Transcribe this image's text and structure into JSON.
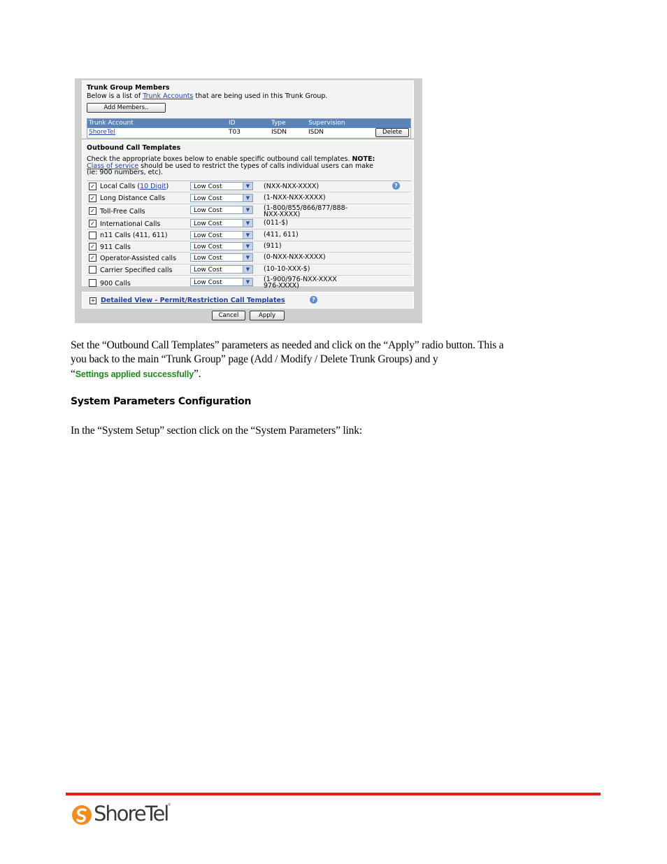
{
  "screenshot": {
    "members": {
      "title": "Trunk Group Members",
      "desc_pre": "Below is a list of ",
      "desc_link": "Trunk Accounts",
      "desc_post": " that are being used in this Trunk Group.",
      "add_button": "Add Members..",
      "columns": [
        "Trunk Account",
        "ID",
        "Type",
        "Supervision"
      ],
      "row": {
        "account": "ShoreTel",
        "id": "T03",
        "type": "ISDN",
        "supervision": "ISDN",
        "action": "Delete"
      }
    },
    "templates": {
      "title": "Outbound Call Templates",
      "desc_line1_pre": "Check the appropriate boxes below to enable specific outbound call templates. ",
      "desc_note": "NOTE:",
      "desc_link": "Class of service",
      "desc_line2_post": " should be used to restrict the types of calls individual users can make",
      "desc_line3": "(ie: 900 numbers, etc).",
      "rows": [
        {
          "checked": true,
          "label": "Local Calls (",
          "link": "10 Digit",
          "label_post": ")",
          "select": "Low Cost",
          "pattern": "(NXX-NXX-XXXX)"
        },
        {
          "checked": true,
          "label": "Long Distance Calls",
          "select": "Low Cost",
          "pattern": "(1-NXX-NXX-XXXX)"
        },
        {
          "checked": true,
          "label": "Toll-Free Calls",
          "select": "Low Cost",
          "pattern": "(1-800/855/866/877/888-\nNXX-XXXX)"
        },
        {
          "checked": true,
          "label": "International Calls",
          "select": "Low Cost",
          "pattern": "(011-$)"
        },
        {
          "checked": false,
          "label": "n11 Calls (411, 611)",
          "select": "Low Cost",
          "pattern": "(411, 611)"
        },
        {
          "checked": true,
          "label": "911 Calls",
          "select": "Low Cost",
          "pattern": "(911)"
        },
        {
          "checked": true,
          "label": "Operator-Assisted calls",
          "select": "Low Cost",
          "pattern": "(0-NXX-NXX-XXXX)"
        },
        {
          "checked": false,
          "label": "Carrier Specified calls",
          "select": "Low Cost",
          "pattern": "(10-10-XXX-$)"
        },
        {
          "checked": false,
          "label": "900 Calls",
          "select": "Low Cost",
          "pattern": "(1-900/976-NXX-XXXX\n976-XXXX)"
        }
      ]
    },
    "detail_link": "Detailed View - Permit/Restriction Call Templates",
    "expand_glyph": "+",
    "cancel_button": "Cancel",
    "apply_button": "Apply"
  },
  "body": {
    "para1_line1": "Set the “Outbound Call Templates” parameters as needed and click on the “Apply” radio button.  This a",
    "para1_line2": "you back to the main “Trunk Group” page (Add / Modify / Delete Trunk Groups) and y",
    "para1_open_quote": "“",
    "success_msg": "Settings applied successfully",
    "para1_close": "”.",
    "heading": "System Parameters Configuration",
    "para2": "In the “System Setup” section click on the “System Parameters” link:"
  },
  "footer": {
    "logo_text": "ShoreTel",
    "logo_reg": "®"
  },
  "colors": {
    "accent_red": "#e01e1e",
    "success_green": "#1f8a1f",
    "table_header": "#5a84b8",
    "logo_orange": "#f28c1e"
  }
}
